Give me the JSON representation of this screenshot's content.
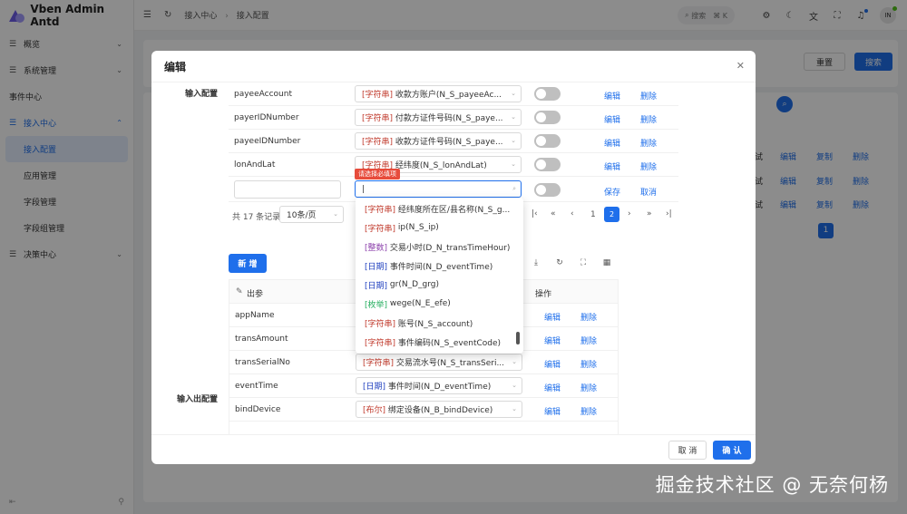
{
  "app": {
    "name": "Vben Admin Antd",
    "watermark": "掘金技术社区 @ 无奈何杨"
  },
  "sidebar": {
    "items": [
      {
        "label": "概览",
        "icon": "menu-icon",
        "expandable": true
      },
      {
        "label": "系统管理",
        "icon": "menu-icon",
        "expandable": true
      },
      {
        "label": "事件中心",
        "icon": "",
        "expandable": false
      },
      {
        "label": "接入中心",
        "icon": "menu-icon",
        "expandable": true,
        "expanded": true
      },
      {
        "label": "决策中心",
        "icon": "menu-icon",
        "expandable": true
      }
    ],
    "subitems": [
      {
        "label": "接入配置",
        "selected": true
      },
      {
        "label": "应用管理"
      },
      {
        "label": "字段管理"
      },
      {
        "label": "字段组管理"
      }
    ]
  },
  "header": {
    "breadcrumb": [
      "接入中心",
      "接入配置"
    ],
    "search_label": "搜索",
    "search_key": "⌘ K",
    "avatar_text": "IN"
  },
  "background": {
    "reset_label": "重置",
    "search_label": "搜索",
    "row_links": [
      "编辑",
      "复制",
      "删除"
    ],
    "row_prefix": "试",
    "current_page": "1"
  },
  "modal": {
    "title": "编辑",
    "input_section_label": "输入配置",
    "io_section_label": "输入出配置",
    "input_rows": [
      {
        "name": "payeeAccount",
        "type": "[字符串]",
        "field": "收款方账户(N_S_payeeAc..."
      },
      {
        "name": "payerIDNumber",
        "type": "[字符串]",
        "field": "付款方证件号码(N_S_paye..."
      },
      {
        "name": "payeeIDNumber",
        "type": "[字符串]",
        "field": "收款方证件号码(N_S_paye..."
      },
      {
        "name": "lonAndLat",
        "type": "[字符串]",
        "field": "经纬度(N_S_lonAndLat)"
      }
    ],
    "edit_label": "编辑",
    "delete_label": "删除",
    "save_label": "保存",
    "cancel_label": "取消",
    "required_tip": "请选择必填项",
    "total_text": "共 17 条记录",
    "page_size": "10条/页",
    "pager": {
      "page1": "1",
      "page2": "2"
    },
    "add_label": "新 增",
    "output_header": "出参",
    "op_header": "操作",
    "output_rows": [
      {
        "name": "appName",
        "type": "",
        "field": ""
      },
      {
        "name": "transAmount",
        "type": "",
        "field": ""
      },
      {
        "name": "transSerialNo",
        "type": "[字符串]",
        "field": "交易流水号(N_S_transSeri..."
      },
      {
        "name": "eventTime",
        "type": "[日期]",
        "field": "事件时间(N_D_eventTime)"
      },
      {
        "name": "bindDevice",
        "type": "[布尔]",
        "field": "绑定设备(N_B_bindDevice)"
      }
    ],
    "cancel_button": "取 消",
    "confirm_button": "确 认"
  },
  "dropdown": {
    "options": [
      {
        "type": "[字符串]",
        "label": "经纬度所在区/县名称(N_S_g..."
      },
      {
        "type": "[字符串]",
        "label": "ip(N_S_ip)"
      },
      {
        "type": "[整数]",
        "label": "交易小时(D_N_transTimeHour)"
      },
      {
        "type": "[日期]",
        "label": "事件时间(N_D_eventTime)"
      },
      {
        "type": "[日期]",
        "label": "gr(N_D_grg)"
      },
      {
        "type": "[枚举]",
        "label": "wege(N_E_efe)"
      },
      {
        "type": "[字符串]",
        "label": "账号(N_S_account)"
      },
      {
        "type": "[字符串]",
        "label": "事件编码(N_S_eventCode)"
      }
    ]
  },
  "colors": {
    "primary": "#1f6feb",
    "string_tag": "#c0392b",
    "integer_tag": "#8e44ad",
    "date_tag": "#1f3fbf",
    "enum_tag": "#27ae60"
  }
}
